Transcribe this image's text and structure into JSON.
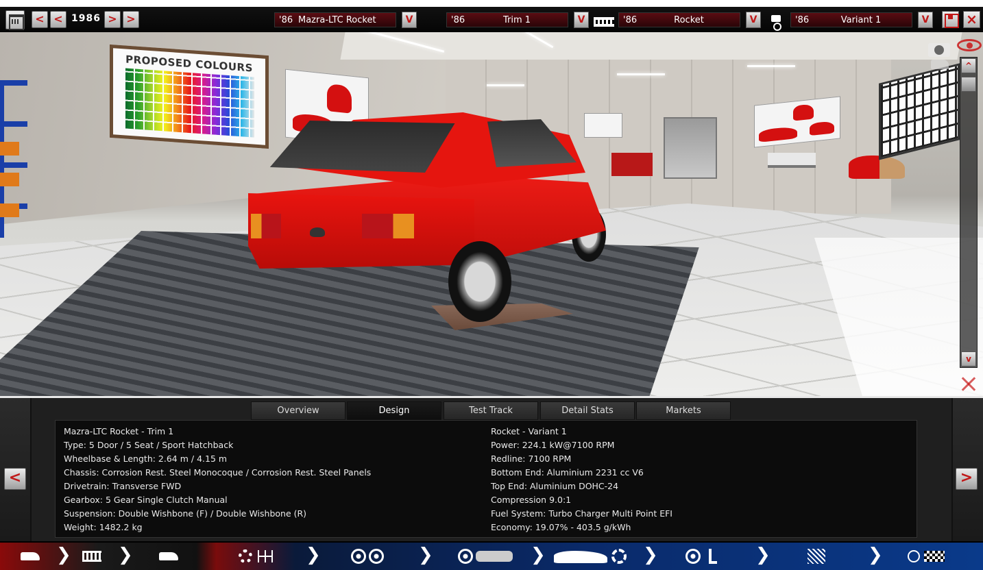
{
  "topbar": {
    "year": "1986",
    "prev_big": "<",
    "prev_small": "<",
    "next_small": ">",
    "next_big": ">",
    "dropdown_glyph": "V",
    "model": {
      "year": "'86",
      "name": "Mazra-LTC Rocket",
      "icon": "car-icon"
    },
    "trim": {
      "year": "'86",
      "name": "Trim 1",
      "icon": "trim-car-icon"
    },
    "engine": {
      "year": "'86",
      "name": "Rocket",
      "icon": "engine-block-icon"
    },
    "variant": {
      "year": "'86",
      "name": "Variant 1",
      "icon": "piston-icon"
    },
    "close_glyph": "×"
  },
  "viewport": {
    "poster_title": "PROPOSED COLOURS",
    "scroll_up": "^",
    "scroll_down": "v",
    "colors": {
      "car_red": "#e5150f",
      "accent_red": "#c01818"
    }
  },
  "panel": {
    "tabs": [
      "Overview",
      "Design",
      "Test Track",
      "Detail Stats",
      "Markets"
    ],
    "active_tab": "Design",
    "prev_arrow": "<",
    "next_arrow": ">",
    "left_stats": [
      "Mazra-LTC Rocket - Trim 1",
      "Type: 5 Door / 5 Seat / Sport Hatchback",
      "Wheelbase & Length: 2.64 m / 4.15 m",
      "Chassis: Corrosion Rest. Steel Monocoque / Corrosion Rest. Steel Panels",
      "Drivetrain: Transverse FWD",
      "Gearbox: 5 Gear Single Clutch Manual",
      "Suspension: Double Wishbone (F) / Double Wishbone (R)",
      "Weight: 1482.2 kg"
    ],
    "right_stats": [
      "Rocket - Variant 1",
      "Power: 224.1 kW@7100 RPM",
      "Redline: 7100 RPM",
      "Bottom End: Aluminium 2231 cc V6",
      "Top End: Aluminium DOHC-24",
      "Compression 9.0:1",
      "Fuel System: Turbo Charger Multi Point EFI",
      "Economy: 19.07% - 403.5 g/kWh"
    ]
  },
  "navbar": {
    "chevron": "❯",
    "steps": [
      {
        "id": "model",
        "icons": [
          "car-icon"
        ]
      },
      {
        "id": "engine",
        "icons": [
          "engine-block-icon"
        ]
      },
      {
        "id": "trim",
        "icons": [
          "trim-car-icon"
        ],
        "active": true
      },
      {
        "id": "drivetrain",
        "icons": [
          "gear-icon",
          "gearshift-icon"
        ]
      },
      {
        "id": "suspension",
        "icons": [
          "wheel-icon",
          "wheel-icon"
        ]
      },
      {
        "id": "body",
        "icons": [
          "rim-icon",
          "chassis-panel-icon"
        ]
      },
      {
        "id": "design",
        "icons": [
          "sportscar-icon",
          "fan-icon"
        ]
      },
      {
        "id": "interior",
        "icons": [
          "steering-wheel-icon",
          "seat-icon"
        ]
      },
      {
        "id": "tuning",
        "icons": [
          "spring-icon"
        ]
      },
      {
        "id": "finish",
        "icons": [
          "gauge-icon",
          "checkered-flag-icon"
        ]
      }
    ]
  }
}
